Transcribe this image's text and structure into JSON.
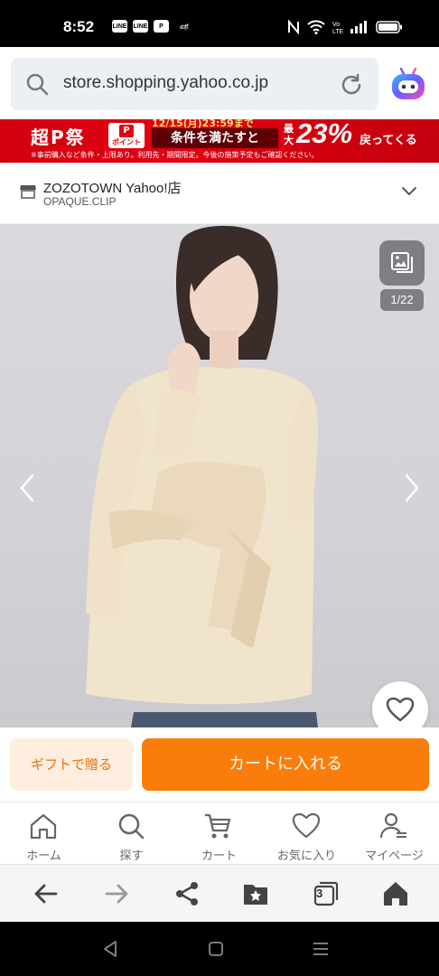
{
  "status_bar": {
    "time": "8:52",
    "notifications": [
      "LINE",
      "LINE",
      "P",
      "dポ"
    ]
  },
  "browser": {
    "url": "store.shopping.yahoo.co.jp"
  },
  "banner": {
    "logo": "超P祭",
    "point_label": "ポイント",
    "date": "12/15(月)23:59まで",
    "condition": "条件を満たすと",
    "max_label": "最大",
    "percent": "23%",
    "back_text": "戻ってくる",
    "note": "※事前購入など条件・上限あり。利用先・期間限定。今後の施策予定もご確認ください。"
  },
  "store": {
    "name": "ZOZOTOWN Yahoo!店",
    "brand": "OPAQUE.CLIP"
  },
  "gallery": {
    "counter": "1/22"
  },
  "actions": {
    "gift_label": "ギフトで贈る",
    "cart_label": "カートに入れる"
  },
  "bottom_nav": {
    "items": [
      {
        "label": "ホーム",
        "icon": "home-icon"
      },
      {
        "label": "探す",
        "icon": "search-icon"
      },
      {
        "label": "カート",
        "icon": "cart-icon"
      },
      {
        "label": "お気に入り",
        "icon": "heart-icon"
      },
      {
        "label": "マイページ",
        "icon": "user-icon"
      }
    ]
  },
  "browser_toolbar": {
    "tab_count": "3"
  },
  "colors": {
    "accent_orange": "#fa7d0b",
    "gift_bg": "#fdeee0",
    "banner_red": "#e20012"
  }
}
